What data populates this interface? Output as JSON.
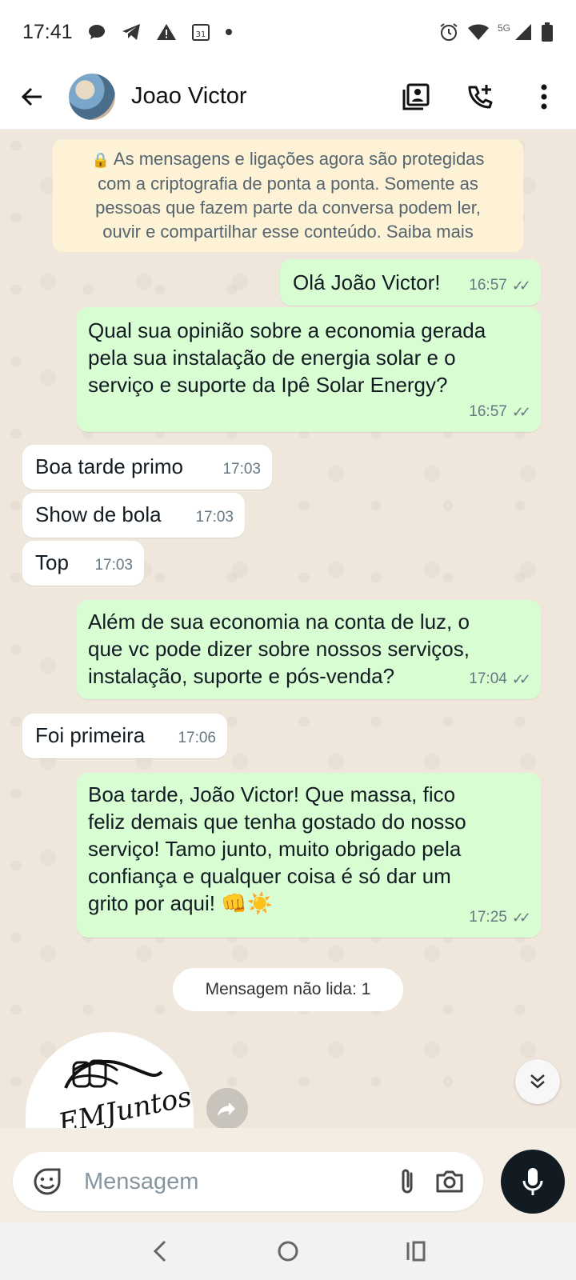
{
  "status_bar": {
    "time": "17:41",
    "calendar_day": "31",
    "network": "5G",
    "icons": [
      "chat-bubble-icon",
      "telegram-icon",
      "warning-icon",
      "calendar-icon",
      "dot-icon",
      "alarm-icon",
      "wifi-icon",
      "signal-icon",
      "battery-icon"
    ]
  },
  "header": {
    "contact_name": "Joao Victor",
    "actions": [
      "contact-card-icon",
      "add-call-icon",
      "more-vert-icon"
    ]
  },
  "encryption_notice": {
    "lines": [
      "As mensagens e ligações agora são protegidas",
      "com a criptografia de ponta a ponta. Somente as",
      "pessoas que fazem parte da conversa podem ler,",
      "ouvir e compartilhar esse conteúdo. Saiba mais"
    ]
  },
  "messages": [
    {
      "direction": "out",
      "lines": [
        "Olá João Victor!"
      ],
      "time": "16:57",
      "status": "read"
    },
    {
      "direction": "out",
      "lines": [
        "Qual sua opinião sobre a economia gerada",
        "pela sua instalação de energia solar e o",
        "serviço e suporte da Ipê Solar Energy?"
      ],
      "time": "16:57",
      "status": "read"
    },
    {
      "direction": "in",
      "lines": [
        "Boa tarde primo"
      ],
      "time": "17:03"
    },
    {
      "direction": "in",
      "lines": [
        "Show de bola"
      ],
      "time": "17:03"
    },
    {
      "direction": "in",
      "lines": [
        "Top"
      ],
      "time": "17:03"
    },
    {
      "direction": "out",
      "lines": [
        "Além de sua economia na conta de luz, o",
        "que vc pode dizer sobre nossos serviços,",
        "instalação, suporte e pós-venda?"
      ],
      "time": "17:04",
      "status": "read"
    },
    {
      "direction": "in",
      "lines": [
        "Foi primeira"
      ],
      "time": "17:06"
    },
    {
      "direction": "out",
      "lines": [
        "Boa tarde, João Victor! Que massa, fico",
        "feliz demais que tenha gostado do nosso",
        "serviço! Tamo junto, muito obrigado pela",
        "confiança e qualquer coisa é só dar um",
        "grito por aqui! 👊☀️"
      ],
      "time": "17:25",
      "status": "read"
    }
  ],
  "unread_divider": "Mensagem não lida: 1",
  "sticker": {
    "text": "EMJuntos"
  },
  "input": {
    "placeholder": "Mensagem"
  },
  "colors": {
    "outgoing_bubble": "#d9fdd3",
    "incoming_bubble": "#ffffff",
    "notice_bg": "#fdf1d6",
    "chat_bg": "#efe7dc",
    "mic_button": "#111b21"
  }
}
